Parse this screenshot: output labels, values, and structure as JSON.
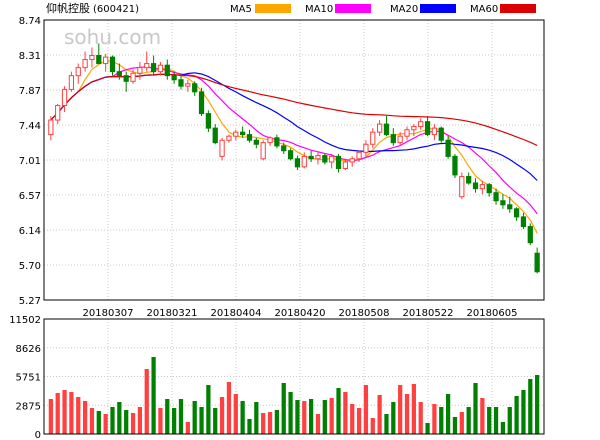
{
  "header": {
    "stock_name": "仰帆控股",
    "stock_code": "(600421)",
    "watermark": "sohu.com"
  },
  "legend": [
    {
      "label": "MA5",
      "color": "#ffa500"
    },
    {
      "label": "MA10",
      "color": "#ff00ff"
    },
    {
      "label": "MA20",
      "color": "#0000ff"
    },
    {
      "label": "MA60",
      "color": "#dd0000"
    }
  ],
  "colors": {
    "up": "#ff4040",
    "down": "#008000",
    "grid": "#c8c8c8",
    "axis": "#000000"
  },
  "chart_data": [
    {
      "type": "candlestick",
      "title": "",
      "x_tick_labels": [
        "20180307",
        "20180321",
        "20180404",
        "20180420",
        "20180508",
        "20180522",
        "20180605"
      ],
      "y_tick_labels": [
        "8.74",
        "8.31",
        "7.87",
        "7.44",
        "7.01",
        "6.57",
        "6.14",
        "5.70",
        "5.27"
      ],
      "ylim": [
        5.27,
        8.74
      ],
      "grid": true,
      "legend_position": "top",
      "candles": [
        [
          7.32,
          7.55,
          7.25,
          7.5
        ],
        [
          7.5,
          7.7,
          7.45,
          7.68
        ],
        [
          7.68,
          7.92,
          7.6,
          7.88
        ],
        [
          7.88,
          8.1,
          7.85,
          8.05
        ],
        [
          8.05,
          8.2,
          7.95,
          8.15
        ],
        [
          8.15,
          8.35,
          8.1,
          8.25
        ],
        [
          8.25,
          8.4,
          8.15,
          8.3
        ],
        [
          8.3,
          8.45,
          8.2,
          8.2
        ],
        [
          8.2,
          8.32,
          8.1,
          8.28
        ],
        [
          8.28,
          8.3,
          8.05,
          8.1
        ],
        [
          8.1,
          8.2,
          8.0,
          8.05
        ],
        [
          8.05,
          8.1,
          7.85,
          7.98
        ],
        [
          7.98,
          8.12,
          7.95,
          8.08
        ],
        [
          8.08,
          8.22,
          8.0,
          8.15
        ],
        [
          8.15,
          8.35,
          8.1,
          8.2
        ],
        [
          8.2,
          8.3,
          8.05,
          8.1
        ],
        [
          8.1,
          8.22,
          8.05,
          8.18
        ],
        [
          8.18,
          8.25,
          8.0,
          8.05
        ],
        [
          8.05,
          8.1,
          7.95,
          8.0
        ],
        [
          8.0,
          8.05,
          7.88,
          7.92
        ],
        [
          7.92,
          8.0,
          7.85,
          7.95
        ],
        [
          7.95,
          7.98,
          7.8,
          7.85
        ],
        [
          7.85,
          7.9,
          7.55,
          7.58
        ],
        [
          7.58,
          7.62,
          7.35,
          7.4
        ],
        [
          7.4,
          7.45,
          7.2,
          7.22
        ],
        [
          7.05,
          7.28,
          7.0,
          7.25
        ],
        [
          7.25,
          7.32,
          7.22,
          7.3
        ],
        [
          7.3,
          7.38,
          7.25,
          7.35
        ],
        [
          7.35,
          7.42,
          7.28,
          7.32
        ],
        [
          7.32,
          7.38,
          7.22,
          7.25
        ],
        [
          7.25,
          7.28,
          7.15,
          7.2
        ],
        [
          7.02,
          7.25,
          7.0,
          7.22
        ],
        [
          7.22,
          7.3,
          7.18,
          7.28
        ],
        [
          7.28,
          7.32,
          7.15,
          7.18
        ],
        [
          7.18,
          7.22,
          7.08,
          7.12
        ],
        [
          7.12,
          7.15,
          7.0,
          7.02
        ],
        [
          7.02,
          7.06,
          6.88,
          6.92
        ],
        [
          6.92,
          7.1,
          6.9,
          7.05
        ],
        [
          7.05,
          7.12,
          6.98,
          7.02
        ],
        [
          7.02,
          7.1,
          6.95,
          7.06
        ],
        [
          7.06,
          7.08,
          6.95,
          6.98
        ],
        [
          6.98,
          7.08,
          6.9,
          7.05
        ],
        [
          7.05,
          7.08,
          6.85,
          6.9
        ],
        [
          6.9,
          7.02,
          6.88,
          6.98
        ],
        [
          6.98,
          7.05,
          6.92,
          7.02
        ],
        [
          7.02,
          7.12,
          6.98,
          7.1
        ],
        [
          7.1,
          7.25,
          7.05,
          7.2
        ],
        [
          7.2,
          7.4,
          7.15,
          7.35
        ],
        [
          7.35,
          7.5,
          7.3,
          7.45
        ],
        [
          7.45,
          7.55,
          7.3,
          7.32
        ],
        [
          7.32,
          7.4,
          7.18,
          7.22
        ],
        [
          7.22,
          7.35,
          7.18,
          7.3
        ],
        [
          7.3,
          7.42,
          7.25,
          7.38
        ],
        [
          7.38,
          7.45,
          7.3,
          7.42
        ],
        [
          7.42,
          7.52,
          7.38,
          7.48
        ],
        [
          7.48,
          7.55,
          7.3,
          7.32
        ],
        [
          7.32,
          7.45,
          7.25,
          7.4
        ],
        [
          7.4,
          7.42,
          7.22,
          7.25
        ],
        [
          7.25,
          7.3,
          7.02,
          7.05
        ],
        [
          7.05,
          7.08,
          6.78,
          6.82
        ],
        [
          6.55,
          6.85,
          6.52,
          6.8
        ],
        [
          6.8,
          6.85,
          6.7,
          6.72
        ],
        [
          6.72,
          6.78,
          6.6,
          6.65
        ],
        [
          6.65,
          6.75,
          6.58,
          6.7
        ],
        [
          6.7,
          6.72,
          6.55,
          6.6
        ],
        [
          6.6,
          6.65,
          6.45,
          6.5
        ],
        [
          6.5,
          6.58,
          6.4,
          6.45
        ],
        [
          6.45,
          6.55,
          6.35,
          6.4
        ],
        [
          6.4,
          6.42,
          6.25,
          6.3
        ],
        [
          6.3,
          6.35,
          6.15,
          6.18
        ],
        [
          6.18,
          6.22,
          5.95,
          5.98
        ],
        [
          5.85,
          5.92,
          5.6,
          5.62
        ]
      ]
    },
    {
      "type": "bar",
      "title": "",
      "y_tick_labels": [
        "11502",
        "8626",
        "5751",
        "2875",
        "0"
      ],
      "ylim": [
        0,
        11502
      ],
      "grid": true,
      "values": [
        3500,
        4100,
        4400,
        4200,
        3700,
        3300,
        2600,
        2300,
        2000,
        2700,
        3200,
        2400,
        2100,
        2700,
        6500,
        7700,
        2600,
        3500,
        2600,
        3500,
        1200,
        3300,
        2700,
        4900,
        2600,
        3700,
        5200,
        4000,
        3300,
        1500,
        3200,
        2100,
        2200,
        2400,
        5100,
        4200,
        3400,
        3300,
        3500,
        2000,
        3400,
        3600,
        4600,
        4200,
        3000,
        2600,
        4900,
        1600,
        3900,
        2000,
        3200,
        4900,
        4000,
        5000,
        3200,
        1100,
        3000,
        2700,
        4000,
        1700,
        2200,
        2700,
        5100,
        3600,
        2700,
        2700,
        1200,
        2700,
        3800,
        4400,
        5500,
        5900,
        5800,
        3900
      ]
    }
  ]
}
